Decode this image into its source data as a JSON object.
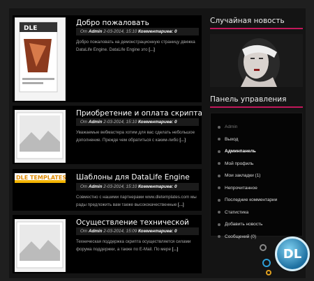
{
  "posts": [
    {
      "title": "Добро пожаловать",
      "meta_on": "От",
      "meta_author": "Admin",
      "meta_date": "2-03-2014, 15:10",
      "meta_comments_label": "Комментариев:",
      "meta_comments": "0",
      "excerpt": "Добро пожаловать на демонстрационную страницу движка DataLife Engine. DataLife Engine это",
      "more": "[...]"
    },
    {
      "title": "Приобретение и оплата скрипта",
      "meta_on": "От",
      "meta_author": "Admin",
      "meta_date": "2-03-2014, 15:10",
      "meta_comments_label": "Комментариев:",
      "meta_comments": "0",
      "excerpt": "Уважаемые вебмастера хотим для вас сделать небольшое дополнение. Прежде чем обратиться с каким-либо",
      "more": "[...]"
    },
    {
      "title": "Шаблоны для DataLife Engine",
      "meta_on": "От",
      "meta_author": "Admin",
      "meta_date": "2-03-2014, 15:10",
      "meta_comments_label": "Комментариев:",
      "meta_comments": "0",
      "excerpt": "Совместно с нашими партнерами www.dletemplates.com мы рады предложить вам также высококачественные",
      "more": "[...]"
    },
    {
      "title": "Осуществление технической",
      "meta_on": "От",
      "meta_author": "Admin",
      "meta_date": "2-03-2014, 15:09",
      "meta_comments_label": "Комментариев:",
      "meta_comments": "0",
      "excerpt": "Техническая поддержка скрипта осуществляется силами форума поддержки, а также по E-Mail. По мере",
      "more": "[...]"
    }
  ],
  "thumb_text": {
    "dle_box": "DLE",
    "dle_templates": "DLE TEMPLATES.COM"
  },
  "sidebar": {
    "random_title": "Случайная новость",
    "panel_title": "Панель управления",
    "menu": [
      {
        "label": "Admin",
        "style": "dim"
      },
      {
        "label": "Выход",
        "style": ""
      },
      {
        "label": "Админпанель",
        "style": "strong"
      },
      {
        "label": "Мой профиль",
        "style": ""
      },
      {
        "label": "Мои закладки (1)",
        "style": ""
      },
      {
        "label": "Непрочитанное",
        "style": ""
      },
      {
        "label": "Последние комментарии",
        "style": ""
      },
      {
        "label": "Статистика",
        "style": ""
      },
      {
        "label": "Добавить новость",
        "style": ""
      },
      {
        "label": "Сообщений (0)",
        "style": ""
      }
    ]
  },
  "logo_text": "DL",
  "accent": "#c2185b"
}
